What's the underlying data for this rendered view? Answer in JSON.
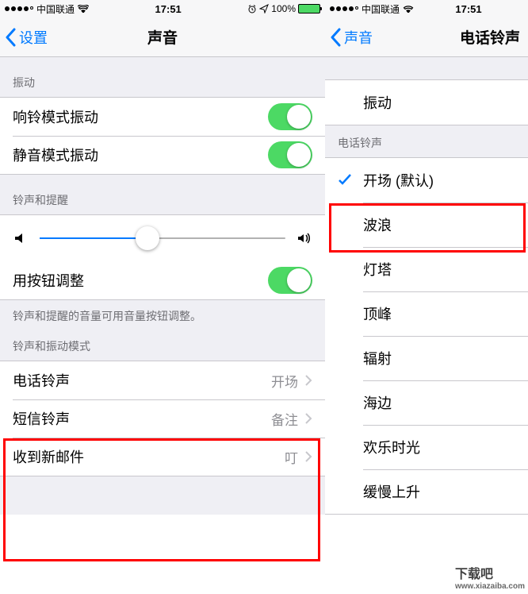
{
  "left": {
    "status": {
      "carrier": "中国联通",
      "time": "17:51",
      "battery": "100%"
    },
    "nav": {
      "back": "设置",
      "title": "声音"
    },
    "section_vibrate": "振动",
    "vibrate1": "响铃模式振动",
    "vibrate2": "静音模式振动",
    "section_ring": "铃声和提醒",
    "adjust_buttons": "用按钮调整",
    "footer": "铃声和提醒的音量可用音量按钮调整。",
    "section_patterns": "铃声和振动模式",
    "rows": [
      {
        "label": "电话铃声",
        "value": "开场"
      },
      {
        "label": "短信铃声",
        "value": "备注"
      },
      {
        "label": "收到新邮件",
        "value": "叮"
      }
    ]
  },
  "right": {
    "status": {
      "carrier": "中国联通",
      "time": "17:51"
    },
    "nav": {
      "back": "声音",
      "title": "电话铃声"
    },
    "section_vibrate": "振动",
    "section_ring": "电话铃声",
    "vibrate_row": "振动",
    "tones": [
      "开场 (默认)",
      "波浪",
      "灯塔",
      "顶峰",
      "辐射",
      "海边",
      "欢乐时光",
      "缓慢上升"
    ]
  },
  "watermark": {
    "main": "下载吧",
    "sub": "www.xiazaiba.com"
  }
}
